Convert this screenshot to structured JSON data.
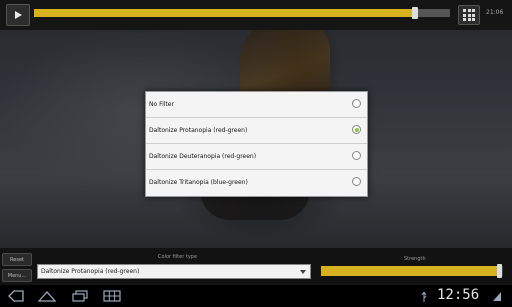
{
  "player": {
    "play_icon": "play-icon",
    "progress": 0.915,
    "time": "21:06",
    "grid_icon": "grid-icon",
    "accent": "#d6b21e"
  },
  "dialog": {
    "options": [
      {
        "label": "No Filter",
        "selected": false
      },
      {
        "label": "Daltonize Protanopia (red-green)",
        "selected": true
      },
      {
        "label": "Daltonize Deuteranopia (red-green)",
        "selected": false
      },
      {
        "label": "Daltonize Tritanopia (blue-green)",
        "selected": false
      }
    ],
    "selected_color": "#8dc63f"
  },
  "controls": {
    "reset_label": "Reset",
    "menu_label": "Menu...",
    "filter_type_label": "Color filter type",
    "filter_type_value": "Daltonize Protanopia (red-green)",
    "strength_label": "Strength",
    "strength": 0.99
  },
  "system": {
    "clock": "12:56",
    "back_icon": "back-icon",
    "home_icon": "home-icon",
    "recents_icon": "recent-apps-icon",
    "menu_icon": "menu-grid-icon"
  }
}
